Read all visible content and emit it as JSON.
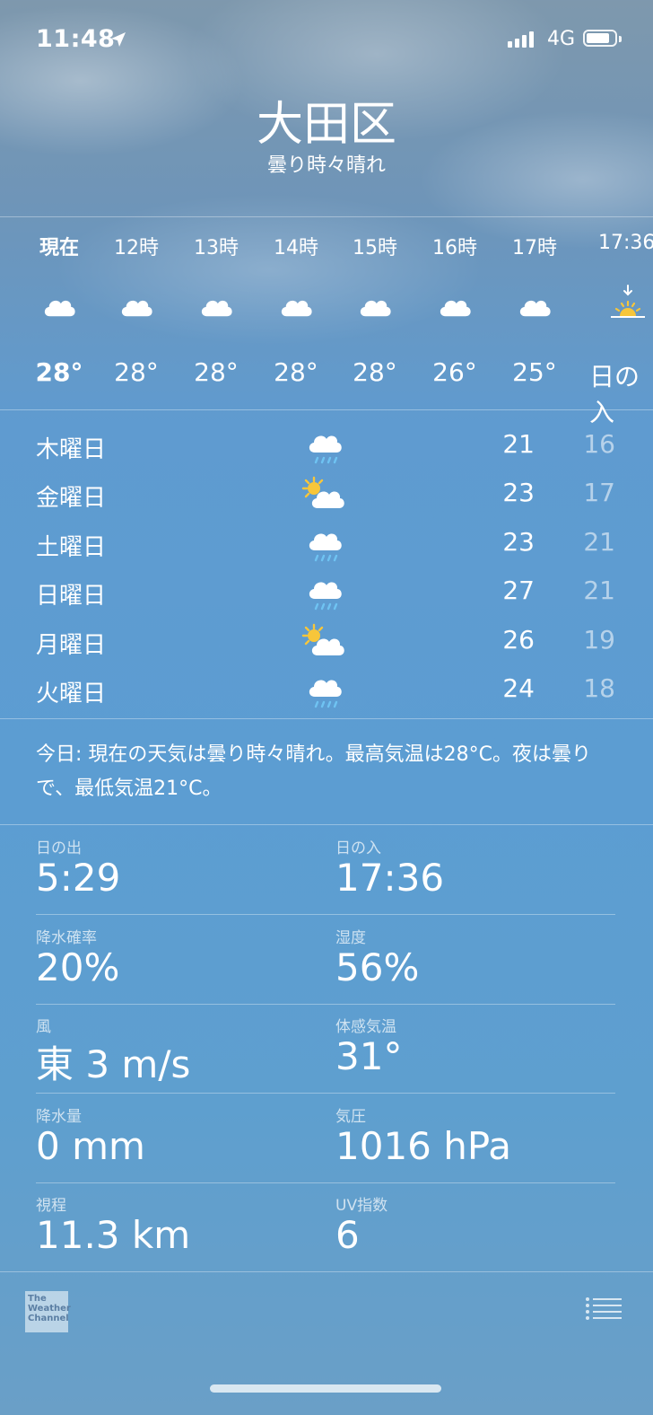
{
  "status_bar": {
    "time": "11:48",
    "network": "4G"
  },
  "location": {
    "city": "大田区",
    "condition": "曇り時々晴れ"
  },
  "hourly": [
    {
      "label": "現在",
      "icon": "cloud-icon",
      "temp": "28°",
      "bold": true
    },
    {
      "label": "12時",
      "icon": "cloud-icon",
      "temp": "28°"
    },
    {
      "label": "13時",
      "icon": "cloud-icon",
      "temp": "28°"
    },
    {
      "label": "14時",
      "icon": "cloud-icon",
      "temp": "28°"
    },
    {
      "label": "15時",
      "icon": "cloud-icon",
      "temp": "28°"
    },
    {
      "label": "16時",
      "icon": "cloud-icon",
      "temp": "26°"
    },
    {
      "label": "17時",
      "icon": "cloud-icon",
      "temp": "25°"
    },
    {
      "label": "17:36",
      "icon": "sunset-icon",
      "temp": "日の入"
    }
  ],
  "daily": [
    {
      "day": "木曜日",
      "icon": "rain-cloud-icon",
      "high": "21",
      "low": "16"
    },
    {
      "day": "金曜日",
      "icon": "partly-cloudy-icon",
      "high": "23",
      "low": "17"
    },
    {
      "day": "土曜日",
      "icon": "rain-cloud-icon",
      "high": "23",
      "low": "21"
    },
    {
      "day": "日曜日",
      "icon": "rain-cloud-icon",
      "high": "27",
      "low": "21"
    },
    {
      "day": "月曜日",
      "icon": "partly-cloudy-icon",
      "high": "26",
      "low": "19"
    },
    {
      "day": "火曜日",
      "icon": "rain-cloud-icon",
      "high": "24",
      "low": "18"
    }
  ],
  "summary": "今日: 現在の天気は曇り時々晴れ。最高気温は28°C。夜は曇りで、最低気温21°C。",
  "details": [
    {
      "label": "日の出",
      "value": "5:29"
    },
    {
      "label": "日の入",
      "value": "17:36"
    },
    {
      "label": "降水確率",
      "value": "20%"
    },
    {
      "label": "湿度",
      "value": "56%"
    },
    {
      "label": "風",
      "value": "東 3 m/s"
    },
    {
      "label": "体感気温",
      "value": "31°"
    },
    {
      "label": "降水量",
      "value": "0 mm"
    },
    {
      "label": "気圧",
      "value": "1016 hPa"
    },
    {
      "label": "視程",
      "value": "11.3 km"
    },
    {
      "label": "UV指数",
      "value": "6"
    }
  ],
  "footer": {
    "logo_text": "The Weather Channel"
  },
  "colors": {
    "sun": "#f7c63a",
    "rain": "#6fc3f2",
    "sky": "#5f9bd0"
  }
}
